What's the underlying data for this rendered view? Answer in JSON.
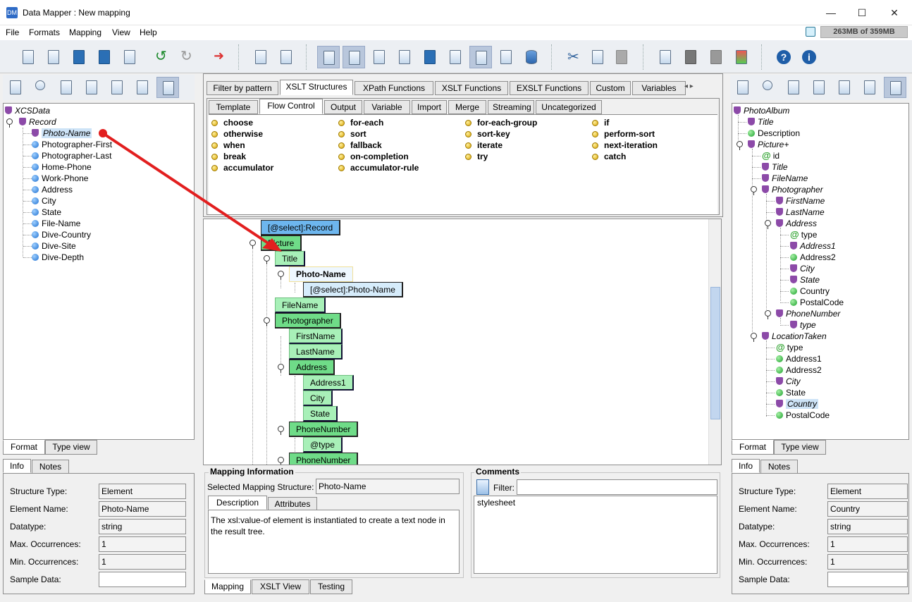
{
  "window": {
    "title": "Data Mapper : New mapping",
    "minimize": "—",
    "maximize": "☐",
    "close": "✕"
  },
  "menu": [
    {
      "label": "File"
    },
    {
      "label": "Formats"
    },
    {
      "label": "Mapping"
    },
    {
      "label": "View"
    },
    {
      "label": "Help"
    }
  ],
  "memory": "263MB of 359MB",
  "left_panel": {
    "root": "XCSData",
    "record": "Record",
    "fields": [
      "Photo-Name",
      "Photographer-First",
      "Photographer-Last",
      "Home-Phone",
      "Work-Phone",
      "Address",
      "City",
      "State",
      "File-Name",
      "Dive-Country",
      "Dive-Site",
      "Dive-Depth"
    ],
    "view_tabs": [
      "Format",
      "Type view"
    ],
    "info_tabs": [
      "Info",
      "Notes"
    ],
    "info": {
      "labels": [
        "Structure Type:",
        "Element Name:",
        "Datatype:",
        "Max. Occurrences:",
        "Min. Occurrences:",
        "Sample Data:"
      ],
      "values": [
        "Element",
        "Photo-Name",
        "string",
        "1",
        "1",
        ""
      ]
    }
  },
  "center": {
    "top_tabs": [
      "Filter by pattern",
      "XSLT Structures",
      "XPath Functions",
      "XSLT Functions",
      "EXSLT Functions",
      "Custom",
      "Variables"
    ],
    "sub_tabs": [
      "Template",
      "Flow Control",
      "Output",
      "Variable",
      "Import",
      "Merge",
      "Streaming",
      "Uncategorized"
    ],
    "flow_items": [
      [
        "choose",
        "otherwise",
        "when",
        "break",
        "accumulator"
      ],
      [
        "for-each",
        "sort",
        "fallback",
        "on-completion",
        "accumulator-rule"
      ],
      [
        "for-each-group",
        "sort-key",
        "iterate",
        "try"
      ],
      [
        "if",
        "perform-sort",
        "next-iteration",
        "catch"
      ]
    ],
    "nodes": {
      "select_record": "[@select]:Record",
      "picture": "Picture",
      "title": "Title",
      "photo_name": "Photo-Name",
      "select_photo": "[@select]:Photo-Name",
      "filename": "FileName",
      "photographer": "Photographer",
      "firstname": "FirstName",
      "lastname": "LastName",
      "address": "Address",
      "address1": "Address1",
      "city": "City",
      "state": "State",
      "phonenumber": "PhoneNumber",
      "type": "@type",
      "phonenumber2": "PhoneNumber"
    },
    "mapping_info": {
      "title": "Mapping Information",
      "selected_label": "Selected Mapping Structure:",
      "selected_value": "Photo-Name",
      "tabs": [
        "Description",
        "Attributes"
      ],
      "description": "The xsl:value-of element is instantiated to create a text node in the result tree."
    },
    "comments": {
      "title": "Comments",
      "filter_label": "Filter:",
      "filter_value": "",
      "text": "stylesheet"
    },
    "bottom_tabs": [
      "Mapping",
      "XSLT View",
      "Testing"
    ]
  },
  "right_panel": {
    "items": [
      {
        "label": "PhotoAlbum",
        "kind": "shield",
        "italic": true
      },
      {
        "label": "Title",
        "kind": "shield",
        "italic": true
      },
      {
        "label": "Description",
        "kind": "green",
        "italic": false
      },
      {
        "label": "Picture+",
        "kind": "shield",
        "italic": true
      },
      {
        "label": "id",
        "kind": "at",
        "italic": false
      },
      {
        "label": "Title",
        "kind": "shield",
        "italic": true
      },
      {
        "label": "FileName",
        "kind": "shield",
        "italic": true
      },
      {
        "label": "Photographer",
        "kind": "shield",
        "italic": true
      },
      {
        "label": "FirstName",
        "kind": "shield",
        "italic": true
      },
      {
        "label": "LastName",
        "kind": "shield",
        "italic": true
      },
      {
        "label": "Address",
        "kind": "shield",
        "italic": true
      },
      {
        "label": "type",
        "kind": "at",
        "italic": false
      },
      {
        "label": "Address1",
        "kind": "shield",
        "italic": true
      },
      {
        "label": "Address2",
        "kind": "green",
        "italic": false
      },
      {
        "label": "City",
        "kind": "shield",
        "italic": true
      },
      {
        "label": "State",
        "kind": "shield",
        "italic": true
      },
      {
        "label": "Country",
        "kind": "green",
        "italic": false
      },
      {
        "label": "PostalCode",
        "kind": "green",
        "italic": false
      },
      {
        "label": "PhoneNumber",
        "kind": "shield",
        "italic": true
      },
      {
        "label": "type",
        "kind": "shieldv",
        "italic": true
      },
      {
        "label": "LocationTaken",
        "kind": "shield",
        "italic": true
      },
      {
        "label": "type",
        "kind": "at",
        "italic": false
      },
      {
        "label": "Address1",
        "kind": "green",
        "italic": false
      },
      {
        "label": "Address2",
        "kind": "green",
        "italic": false
      },
      {
        "label": "City",
        "kind": "shield",
        "italic": true
      },
      {
        "label": "State",
        "kind": "green",
        "italic": false
      },
      {
        "label": "Country",
        "kind": "shield",
        "italic": true
      },
      {
        "label": "PostalCode",
        "kind": "green",
        "italic": false
      }
    ],
    "view_tabs": [
      "Format",
      "Type view"
    ],
    "info_tabs": [
      "Info",
      "Notes"
    ],
    "info": {
      "labels": [
        "Structure Type:",
        "Element Name:",
        "Datatype:",
        "Max. Occurrences:",
        "Min. Occurrences:",
        "Sample Data:"
      ],
      "values": [
        "Element",
        "Country",
        "string",
        "1",
        "1",
        ""
      ]
    }
  }
}
